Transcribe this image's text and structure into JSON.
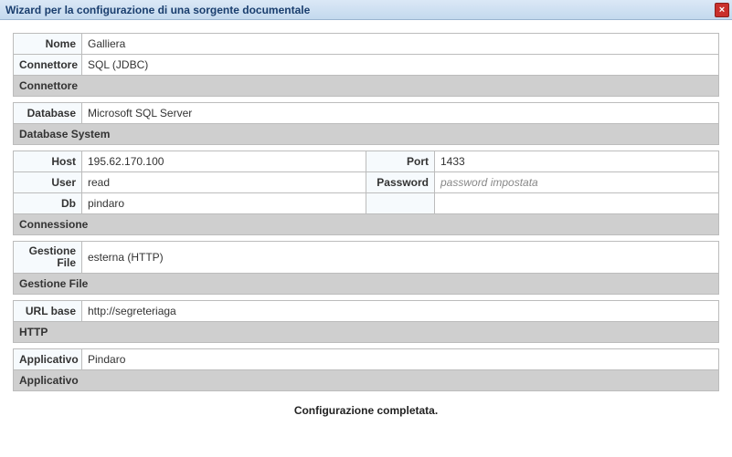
{
  "window": {
    "title": "Wizard per la configurazione di una sorgente documentale",
    "close": "×"
  },
  "block1": {
    "nome_label": "Nome",
    "nome_value": "Galliera",
    "connettore_label": "Connettore",
    "connettore_value": "SQL (JDBC)",
    "section": "Connettore"
  },
  "block2": {
    "database_label": "Database",
    "database_value": "Microsoft SQL Server",
    "section": "Database System"
  },
  "block3": {
    "host_label": "Host",
    "host_value": "195.62.170.100",
    "port_label": "Port",
    "port_value": "1433",
    "user_label": "User",
    "user_value": "read",
    "password_label": "Password",
    "password_placeholder": "password impostata",
    "db_label": "Db",
    "db_value": "pindaro",
    "section": "Connessione"
  },
  "block4": {
    "gf_label": "Gestione File",
    "gf_value": "esterna (HTTP)",
    "section": "Gestione File"
  },
  "block5": {
    "url_label": "URL base",
    "url_value": "http://segreteriaga",
    "section": "HTTP"
  },
  "block6": {
    "app_label": "Applicativo",
    "app_value": "Pindaro",
    "section": "Applicativo"
  },
  "footer": "Configurazione completata."
}
